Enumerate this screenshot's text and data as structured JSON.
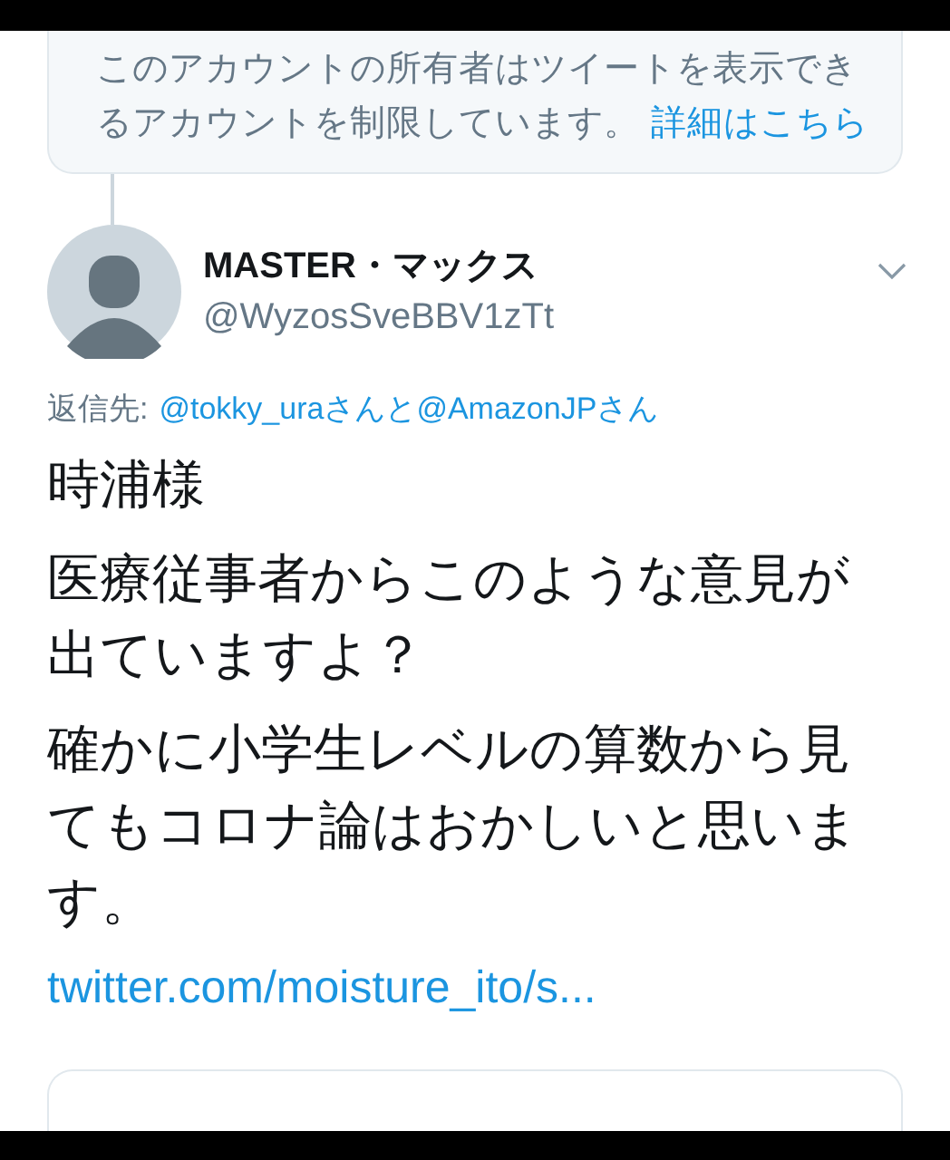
{
  "notice": {
    "text": "このアカウントの所有者はツイートを表示できるアカウントを制限しています。",
    "link": "詳細はこちら"
  },
  "tweet": {
    "name": "MASTER・マックス",
    "handle": "@WyzosSveBBV1zTt",
    "reply_label": "返信先:",
    "reply_to": "@tokky_uraさんと@AmazonJPさん",
    "paragraphs": [
      "時浦様",
      "医療従事者からこのような意見が出ていますよ？",
      "確かに小学生レベルの算数から見てもコロナ論はおかしいと思います。"
    ],
    "link": "twitter.com/moisture_ito/s..."
  }
}
